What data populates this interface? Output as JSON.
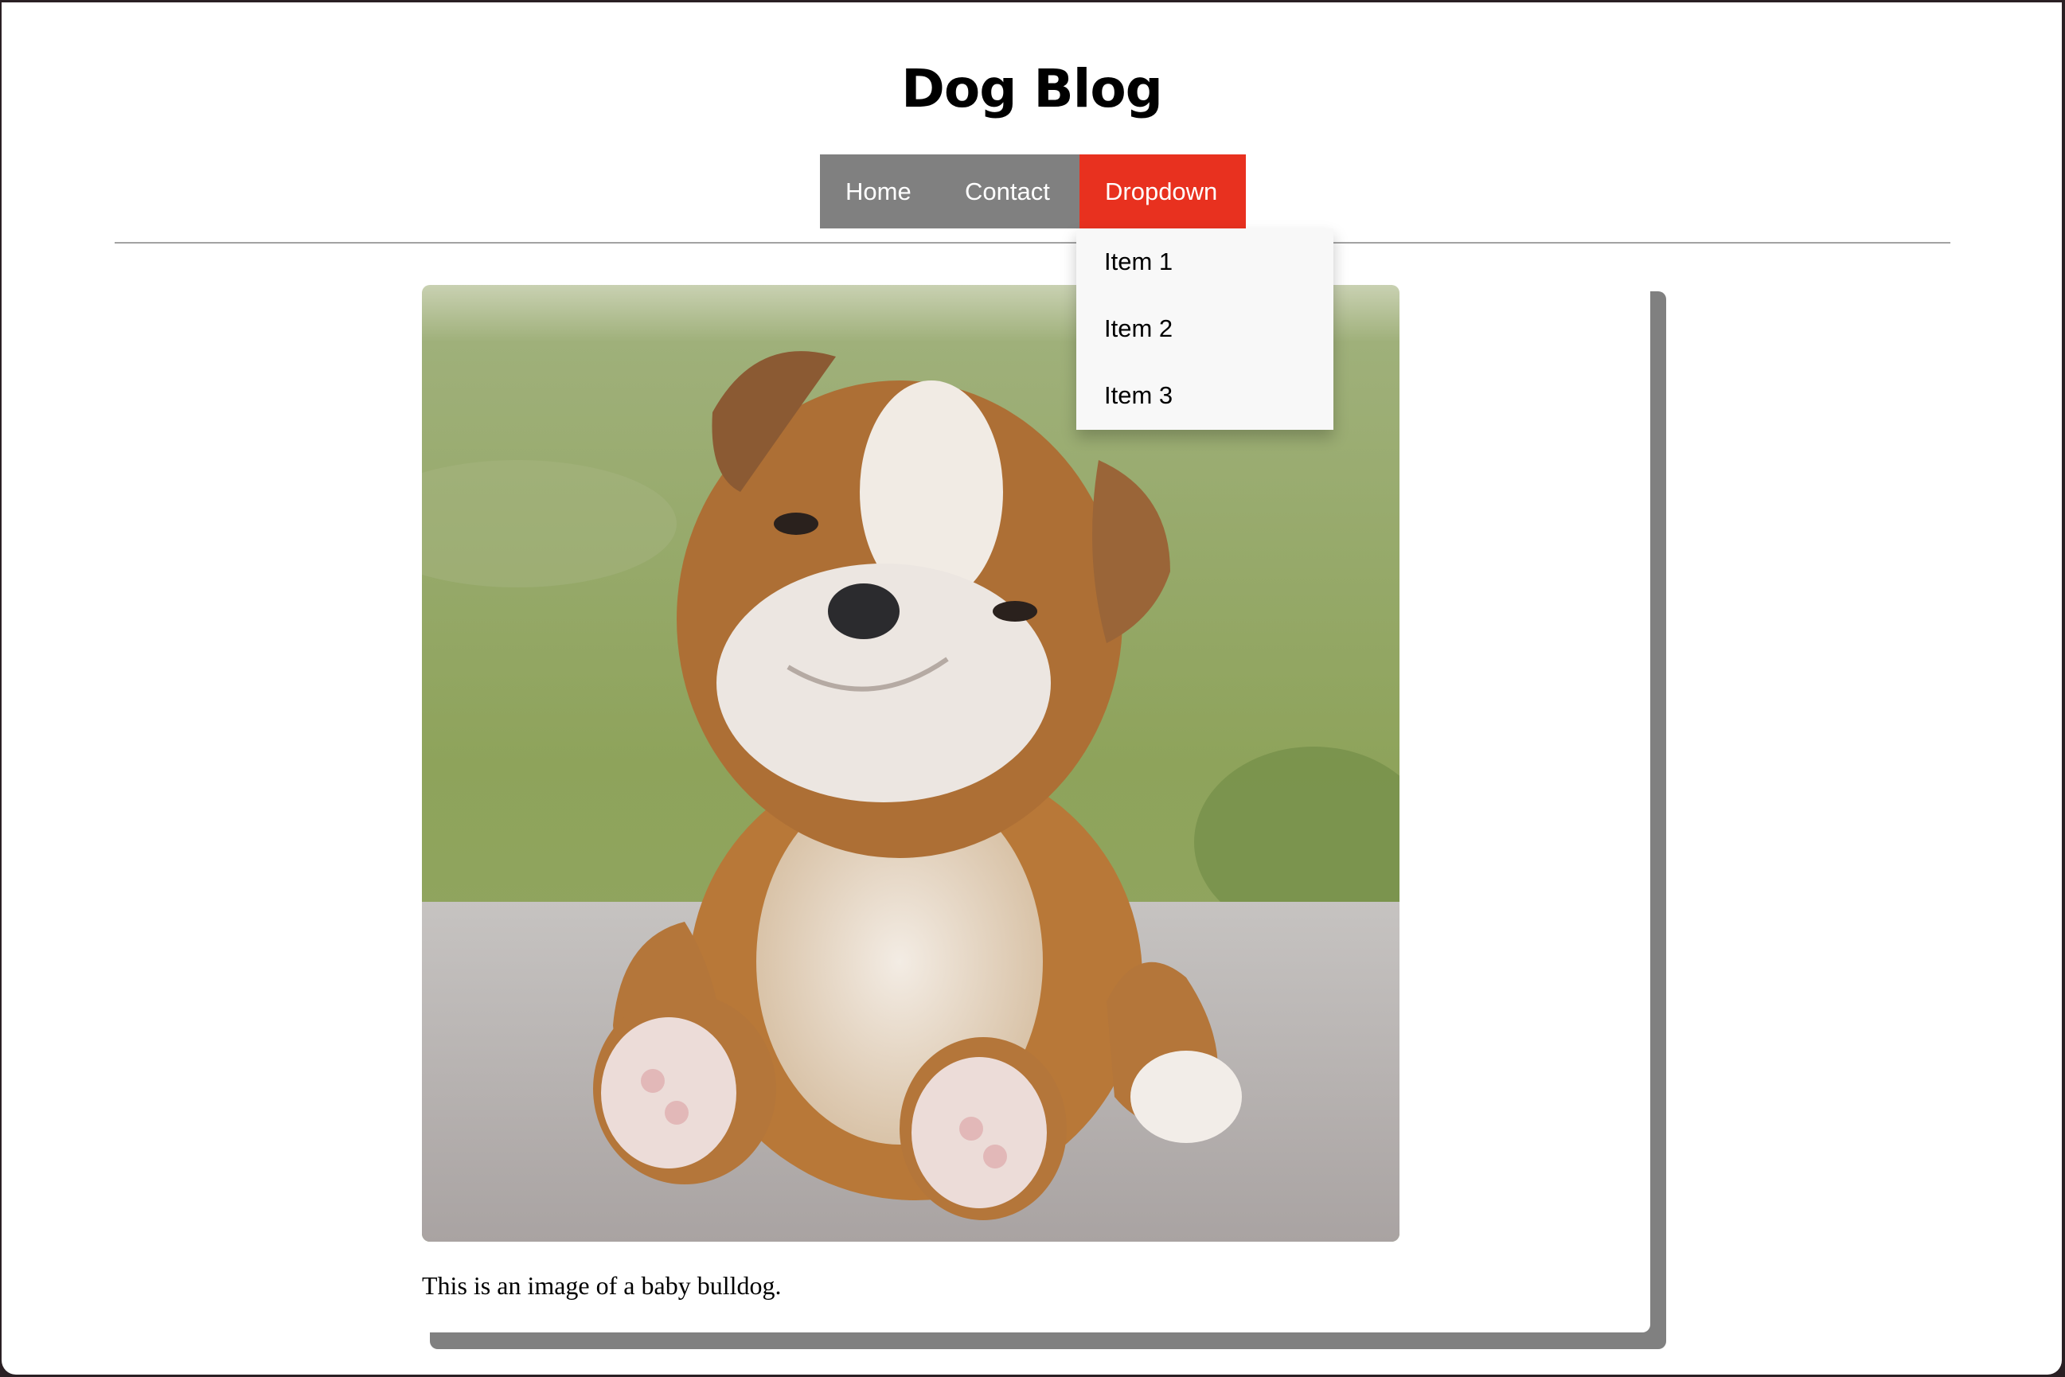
{
  "site": {
    "title": "Dog Blog"
  },
  "nav": {
    "items": [
      {
        "label": "Home"
      },
      {
        "label": "Contact"
      },
      {
        "label": "Dropdown"
      }
    ],
    "active_color": "#e8311f",
    "bar_color": "#808080"
  },
  "dropdown": {
    "items": [
      {
        "label": "Item 1"
      },
      {
        "label": "Item 2"
      },
      {
        "label": "Item 3"
      }
    ]
  },
  "post": {
    "image_subject": "baby bulldog puppy photo",
    "caption": "This is an image of a baby bulldog."
  }
}
